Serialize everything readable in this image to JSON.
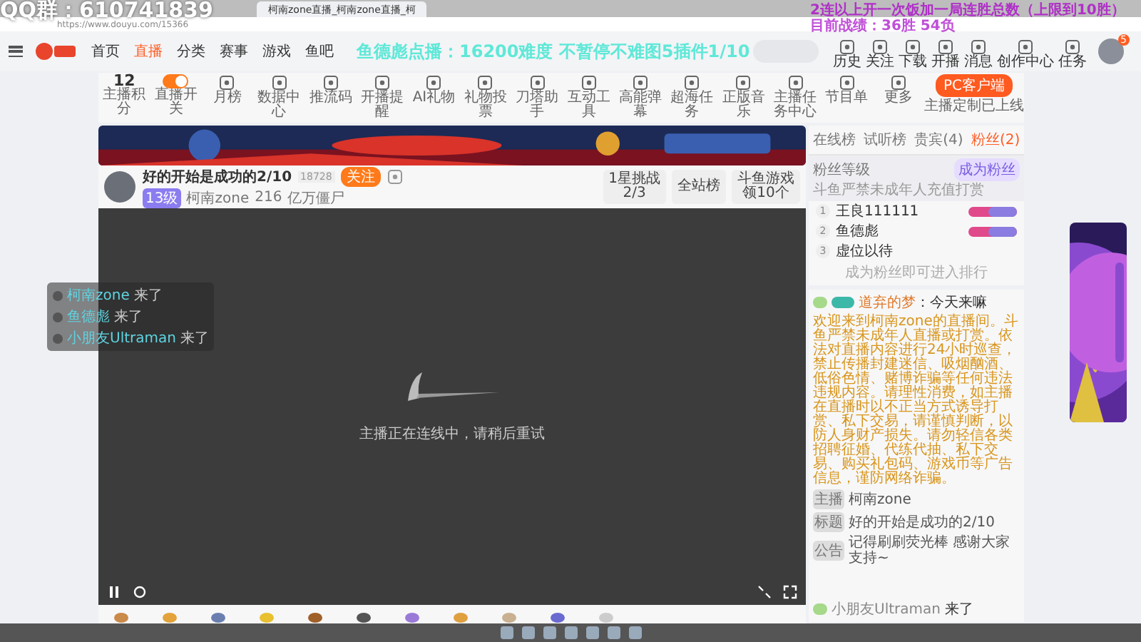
{
  "browser": {
    "tab_title": "柯南zone直播_柯南zone直播_柯",
    "url": "https://www.douyu.com/15366"
  },
  "overlays": {
    "qq": "QQ群：610741839",
    "request": "鱼德彪点播：16200难度 不暂停不难图5插件1/10",
    "rule": "2连以上开一次饭加一局连胜总数（上限到10胜）",
    "record": "目前战绩：36胜 54负"
  },
  "header": {
    "nav": [
      {
        "label": "首页",
        "selected": false
      },
      {
        "label": "直播",
        "selected": true
      },
      {
        "label": "分类",
        "selected": false
      },
      {
        "label": "赛事",
        "selected": false
      },
      {
        "label": "游戏",
        "selected": false
      },
      {
        "label": "鱼吧",
        "selected": false
      }
    ],
    "icons": [
      "历史",
      "关注",
      "下载",
      "开播",
      "消息",
      "创作中心",
      "任务"
    ],
    "avatar_badge": "5"
  },
  "toolbar": {
    "items": [
      {
        "kind": "score",
        "value": "12",
        "label": "主播积分"
      },
      {
        "kind": "toggle",
        "label": "直播开关",
        "on": true
      },
      {
        "kind": "tool",
        "label": "月榜"
      },
      {
        "kind": "tool",
        "label": "数据中心"
      },
      {
        "kind": "tool",
        "label": "推流码"
      },
      {
        "kind": "tool",
        "label": "开播提醒"
      },
      {
        "kind": "tool",
        "label": "AI礼物"
      },
      {
        "kind": "tool",
        "label": "礼物投票"
      },
      {
        "kind": "tool",
        "label": "刀塔助手"
      },
      {
        "kind": "tool",
        "label": "互动工具"
      },
      {
        "kind": "tool",
        "label": "高能弹幕"
      },
      {
        "kind": "tool",
        "label": "超海任务"
      },
      {
        "kind": "tool",
        "label": "正版音乐"
      },
      {
        "kind": "tool",
        "label": "主播任务中心"
      },
      {
        "kind": "tool",
        "label": "节目单"
      },
      {
        "kind": "tool",
        "label": "更多"
      }
    ],
    "client_button": "PC客户端",
    "client_note": "主播定制已上线"
  },
  "room": {
    "title": "好的开始是成功的2/10",
    "room_id": "18728",
    "follow": "关注",
    "level_badge": "13级",
    "anchor": "柯南zone",
    "heat": "216",
    "category": "亿万僵尸",
    "challenges": [
      {
        "line1": "1星挑战",
        "line2": "2/3"
      },
      {
        "line1": "全站榜"
      },
      {
        "line1": "斗鱼游戏",
        "line2": "领10个"
      }
    ]
  },
  "player": {
    "message": "主播正在连线中，请稍后重试",
    "paused": false
  },
  "entrances": [
    {
      "name": "柯南zone",
      "text": "来了"
    },
    {
      "name": "鱼德彪",
      "text": "来了"
    },
    {
      "name": "小朋友Ultraman",
      "text": "来了"
    }
  ],
  "ranking": {
    "tabs": [
      {
        "label": "在线榜",
        "selected": false
      },
      {
        "label": "试听榜",
        "selected": false
      },
      {
        "label": "贵宾(4)",
        "selected": false
      },
      {
        "label": "粉丝(2)",
        "selected": true
      }
    ],
    "fan_level": "粉丝等级",
    "notice": "斗鱼严禁未成年人充值打赏",
    "join": "成为粉丝",
    "rows": [
      {
        "rank": "1",
        "name": "王良111111",
        "badge": true
      },
      {
        "rank": "2",
        "name": "鱼德彪",
        "badge": true
      },
      {
        "rank": "3",
        "name": "虚位以待",
        "badge": false
      }
    ],
    "hint": "成为粉丝即可进入排行"
  },
  "chat": {
    "first": {
      "user": "道弃的梦",
      "text": "：今天来嘛"
    },
    "system": "欢迎来到柯南zone的直播间。斗鱼严禁未成年人直播或打赏。依法对直播内容进行24小时巡查，禁止传播封建迷信、吸烟酗酒、低俗色情、赌博诈骗等任何违法违规内容。请理性消费，如主播在直播时以不正当方式诱导打赏、私下交易，请谨慎判断，以防人身财产损失。请勿轻信各类招聘征婚、代练代抽、私下交易、购买礼包码、游戏币等广告信息，谨防网络诈骗。",
    "info": [
      {
        "tag": "主播",
        "text": "柯南zone"
      },
      {
        "tag": "标题",
        "text": "好的开始是成功的2/10"
      },
      {
        "tag": "公告",
        "text": "记得刷刷荧光棒 感谢大家支持~"
      }
    ],
    "last": {
      "name": "小朋友Ultraman",
      "text": "来了"
    }
  }
}
